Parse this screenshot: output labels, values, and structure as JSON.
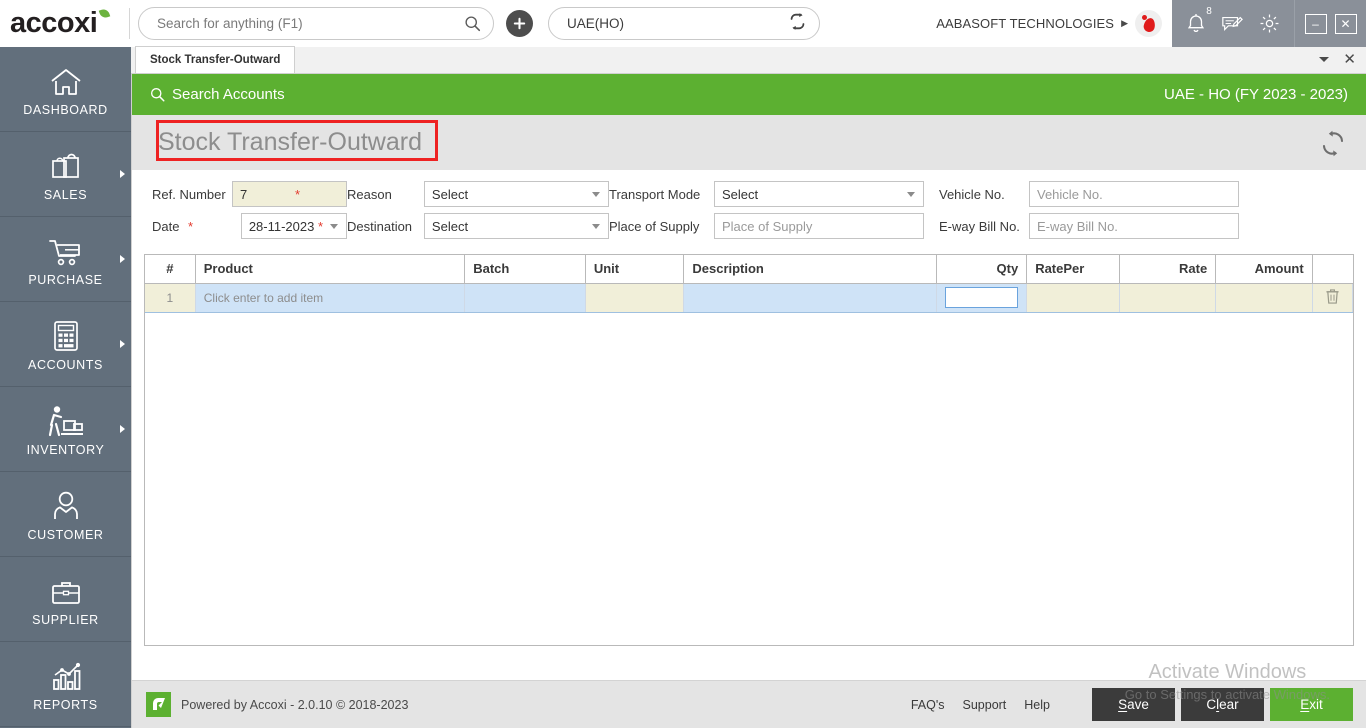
{
  "colors": {
    "brand_green": "#5cb031",
    "sidebar": "#626f7c",
    "accent_red": "#ee2222",
    "required_red": "#e33a2e",
    "row_blue": "#cfe3f7",
    "row_beige": "#f1efd9",
    "sys_gray": "#8a9099"
  },
  "topbar": {
    "logo_text": "accoxi",
    "logo_leaf_icon": "leaf-icon",
    "search": {
      "placeholder": "Search for anything (F1)",
      "value": "",
      "icon": "search-icon"
    },
    "add_button_icon": "plus-icon",
    "branch": {
      "value": "UAE(HO)",
      "switch_icon": "switch-branch-icon"
    },
    "company_name": "AABASOFT TECHNOLOGIES",
    "company_caret_icon": "caret-right-icon",
    "avatar_icon": "user-avatar-icon",
    "system_icons": [
      {
        "name": "notification-bell-icon",
        "badge": "8"
      },
      {
        "name": "message-icon",
        "badge": ""
      },
      {
        "name": "settings-gear-icon",
        "badge": ""
      }
    ],
    "window_controls": [
      {
        "name": "minimize-button",
        "glyph": "–"
      },
      {
        "name": "close-button",
        "glyph": "✕"
      }
    ]
  },
  "sidebar": {
    "items": [
      {
        "label": "DASHBOARD",
        "icon": "home-icon",
        "has_arrow": false
      },
      {
        "label": "SALES",
        "icon": "shopping-bag-icon",
        "has_arrow": true
      },
      {
        "label": "PURCHASE",
        "icon": "shopping-cart-icon",
        "has_arrow": true
      },
      {
        "label": "ACCOUNTS",
        "icon": "calculator-icon",
        "has_arrow": true
      },
      {
        "label": "INVENTORY",
        "icon": "warehouse-worker-icon",
        "has_arrow": true
      },
      {
        "label": "CUSTOMER",
        "icon": "person-icon",
        "has_arrow": false
      },
      {
        "label": "SUPPLIER",
        "icon": "briefcase-icon",
        "has_arrow": false
      },
      {
        "label": "REPORTS",
        "icon": "bar-chart-icon",
        "has_arrow": false
      }
    ]
  },
  "tabstrip": {
    "tabs": [
      {
        "label": "Stock Transfer-Outward",
        "active": true
      }
    ],
    "dropdown_icon": "chevron-down-icon",
    "close_icon": "close-icon"
  },
  "greenbar": {
    "search_accounts_label": "Search Accounts",
    "search_icon": "search-icon",
    "fiscal_year": "UAE - HO (FY 2023 - 2023)"
  },
  "page": {
    "title": "Stock Transfer-Outward",
    "refresh_icon": "refresh-icon",
    "highlight_box": "red-annotation-box"
  },
  "form": {
    "ref_number": {
      "label": "Ref. Number",
      "value": "7",
      "required": false
    },
    "date": {
      "label": "Date",
      "value": "28-11-2023",
      "required": true,
      "icon": "calendar-dropdown-icon"
    },
    "reason": {
      "label": "Reason",
      "value": "Select",
      "required": true
    },
    "destination": {
      "label": "Destination",
      "value": "Select",
      "required": true
    },
    "transport_mode": {
      "label": "Transport Mode",
      "value": "Select",
      "required": false
    },
    "place_of_supply": {
      "label": "Place of Supply",
      "value": "",
      "placeholder": "Place of Supply",
      "required": false
    },
    "vehicle_no": {
      "label": "Vehicle No.",
      "value": "",
      "placeholder": "Vehicle No.",
      "required": false
    },
    "eway_bill_no": {
      "label": "E-way Bill No.",
      "value": "",
      "placeholder": "E-way Bill No.",
      "required": false
    }
  },
  "grid": {
    "columns": [
      {
        "key": "idx",
        "label": "#"
      },
      {
        "key": "product",
        "label": "Product"
      },
      {
        "key": "batch",
        "label": "Batch"
      },
      {
        "key": "unit",
        "label": "Unit"
      },
      {
        "key": "description",
        "label": "Description"
      },
      {
        "key": "qty",
        "label": "Qty"
      },
      {
        "key": "rateper",
        "label": "RatePer"
      },
      {
        "key": "rate",
        "label": "Rate"
      },
      {
        "key": "amount",
        "label": "Amount"
      },
      {
        "key": "action",
        "label": ""
      }
    ],
    "rows": [
      {
        "idx": "1",
        "product": "Click enter to add item",
        "batch": "",
        "unit": "",
        "description": "",
        "qty": "",
        "rateper": "",
        "rate": "",
        "amount": "",
        "delete_icon": "trash-icon"
      }
    ]
  },
  "footer": {
    "logo_icon": "accoxi-mark-icon",
    "copyright": "Powered by Accoxi - 2.0.10 © 2018-2023",
    "links": [
      {
        "label": "FAQ's"
      },
      {
        "label": "Support"
      },
      {
        "label": "Help"
      }
    ],
    "buttons": [
      {
        "label": "Save",
        "accel": "S",
        "style": "dark"
      },
      {
        "label": "Clear",
        "accel": "l",
        "style": "dark"
      },
      {
        "label": "Exit",
        "accel": "E",
        "style": "green"
      }
    ]
  },
  "watermark": {
    "line1": "Activate Windows",
    "line2": "Go to Settings to activate Windows."
  }
}
